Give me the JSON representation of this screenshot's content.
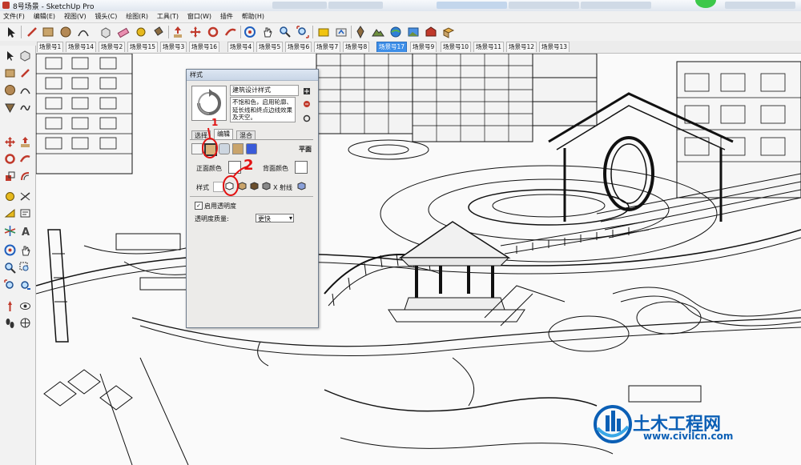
{
  "window": {
    "title": "8号场景 - SketchUp Pro"
  },
  "menu": [
    "文件(F)",
    "编辑(E)",
    "视图(V)",
    "镜头(C)",
    "绘图(R)",
    "工具(T)",
    "窗口(W)",
    "插件",
    "帮助(H)"
  ],
  "scene_tabs": {
    "items": [
      "场景号1",
      "场景号14",
      "场景号2",
      "场景号15",
      "场景号3",
      "场景号16",
      "场景号4",
      "场景号5",
      "场景号6",
      "场景号7",
      "场景号8",
      "场景号17",
      "场景号9",
      "场景号10",
      "场景号11",
      "场景号12",
      "场景号13"
    ],
    "active": "场景号17"
  },
  "style_panel": {
    "title": "样式",
    "style_name": "建筑设计样式",
    "description": "不饱和色，启用轮廓、延长线和终点边线效果及天空。",
    "tabs": [
      "选择",
      "编辑",
      "混合"
    ],
    "active_tab": "编辑",
    "face_setting_label": "平面",
    "front_color_label": "正面颜色",
    "back_color_label": "背面颜色",
    "style_label": "样式",
    "xray_label": "X 射线",
    "transparency_checkbox": "启用透明度",
    "transparency_checked": true,
    "quality_label": "透明度质量:",
    "quality_value": "更快"
  },
  "annotations": {
    "mark1": "1",
    "mark2": "2"
  },
  "watermark": {
    "name": "土木工程网",
    "url": "www.civilcn.com"
  },
  "colors": {
    "accent": "#3d8ee8",
    "annotation": "#e21212",
    "watermark": "#0b5fb5"
  }
}
